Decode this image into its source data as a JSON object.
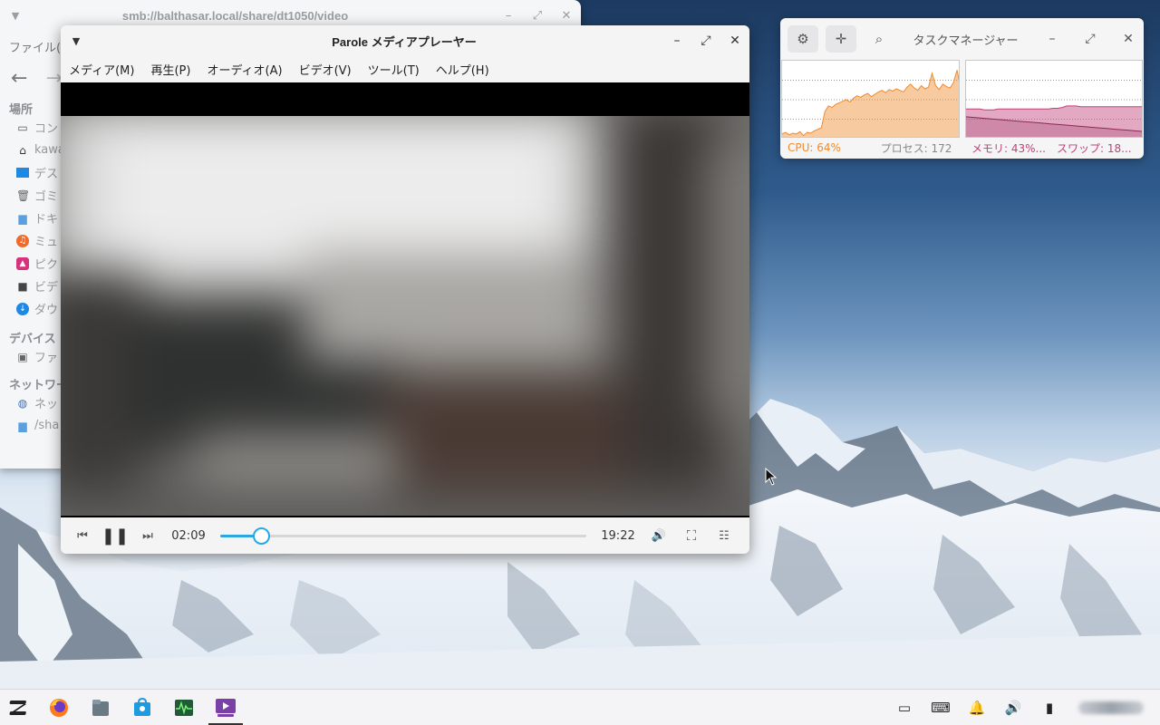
{
  "file_manager": {
    "title": "smb://balthasar.local/share/dt1050/video",
    "menu_label": "ファイル(",
    "back_icon": "arrow-left-icon",
    "forward_icon": "arrow-right-icon",
    "sections": {
      "places": "場所",
      "devices": "デバイス",
      "network": "ネットワー"
    },
    "places": [
      {
        "icon": "computer-icon",
        "label": "コン"
      },
      {
        "icon": "home-icon",
        "label": "kawa"
      },
      {
        "icon": "desktop-icon",
        "label": "デス"
      },
      {
        "icon": "trash-icon",
        "label": "ゴミ"
      },
      {
        "icon": "folder-icon",
        "label": "ドキ"
      },
      {
        "icon": "music-icon",
        "label": "ミュ"
      },
      {
        "icon": "pictures-icon",
        "label": "ピク"
      },
      {
        "icon": "videos-icon",
        "label": "ビデ"
      },
      {
        "icon": "download-icon",
        "label": "ダウ"
      }
    ],
    "devices": [
      {
        "icon": "drive-icon",
        "label": "ファ"
      }
    ],
    "network": [
      {
        "icon": "network-icon",
        "label": "ネッ"
      },
      {
        "icon": "network-folder-icon",
        "label": "/sha"
      }
    ]
  },
  "player": {
    "title": "Parole メディアプレーヤー",
    "menus": [
      "メディア(M)",
      "再生(P)",
      "オーディオ(A)",
      "ビデオ(V)",
      "ツール(T)",
      "ヘルプ(H)"
    ],
    "current_time": "02:09",
    "total_time": "19:22",
    "progress_fraction": 0.111
  },
  "task_manager": {
    "title": "タスクマネージャー",
    "cpu_label": "CPU: 64%",
    "processes_label": "プロセス: 172",
    "memory_label": "メモリ: 43%...",
    "swap_label": "スワップ: 18...",
    "cpu_color": "#f08a2c",
    "memory_color": "#c0407a",
    "cpu_history": [
      6,
      8,
      5,
      7,
      6,
      9,
      4,
      8,
      7,
      10,
      12,
      14,
      35,
      42,
      40,
      44,
      46,
      48,
      50,
      47,
      52,
      55,
      53,
      56,
      58,
      54,
      57,
      60,
      62,
      59,
      63,
      61,
      64,
      62,
      60,
      66,
      70,
      65,
      62,
      68,
      64,
      66,
      84,
      68,
      63,
      70,
      67,
      65,
      72,
      88,
      64
    ],
    "memory_history": [
      38,
      38,
      38,
      38,
      37,
      37,
      37,
      38,
      38,
      38,
      38,
      38,
      38,
      38,
      38,
      38,
      38,
      38,
      38,
      39,
      39,
      40,
      42,
      42,
      42,
      41,
      41,
      41,
      41,
      41,
      41,
      41,
      41,
      41,
      41,
      41,
      41,
      41,
      41,
      41
    ],
    "swap_history": [
      28,
      27,
      26,
      25,
      24,
      23,
      22,
      21,
      20,
      19,
      18,
      17,
      16,
      15,
      14,
      13,
      12,
      11,
      10,
      9
    ]
  },
  "taskbar": {
    "apps": [
      {
        "name": "zorin-menu-icon"
      },
      {
        "name": "firefox-icon"
      },
      {
        "name": "files-icon"
      },
      {
        "name": "software-store-icon"
      },
      {
        "name": "system-monitor-icon"
      },
      {
        "name": "media-player-icon"
      }
    ],
    "tray": [
      "screen-icon",
      "keyboard-icon",
      "bell-icon",
      "volume-icon",
      "battery-icon"
    ]
  }
}
